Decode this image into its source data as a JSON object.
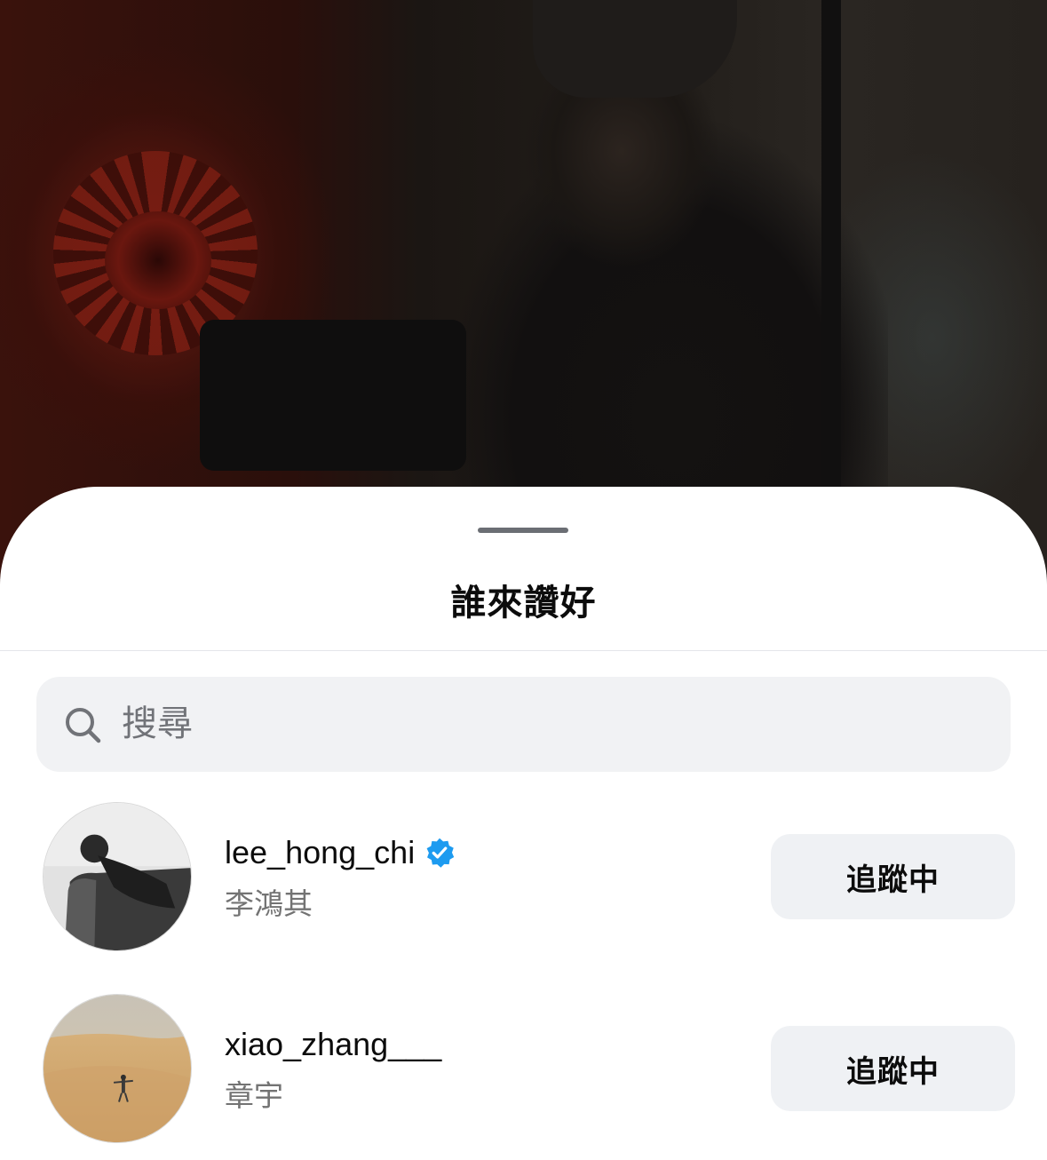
{
  "sheet": {
    "title": "誰來讚好"
  },
  "search": {
    "placeholder": "搜尋"
  },
  "likers": [
    {
      "username": "lee_hong_chi",
      "full_name": "李鴻其",
      "verified": true,
      "button_label": "追蹤中"
    },
    {
      "username": "xiao_zhang___",
      "full_name": "章宇",
      "verified": false,
      "button_label": "追蹤中"
    }
  ],
  "colors": {
    "verified_badge": "#1d9bf0",
    "search_bg": "#f1f2f4",
    "button_bg": "#eff1f4",
    "secondary_text": "#737373"
  },
  "icons": {
    "search": "search-icon",
    "verified": "verified-badge-icon"
  }
}
